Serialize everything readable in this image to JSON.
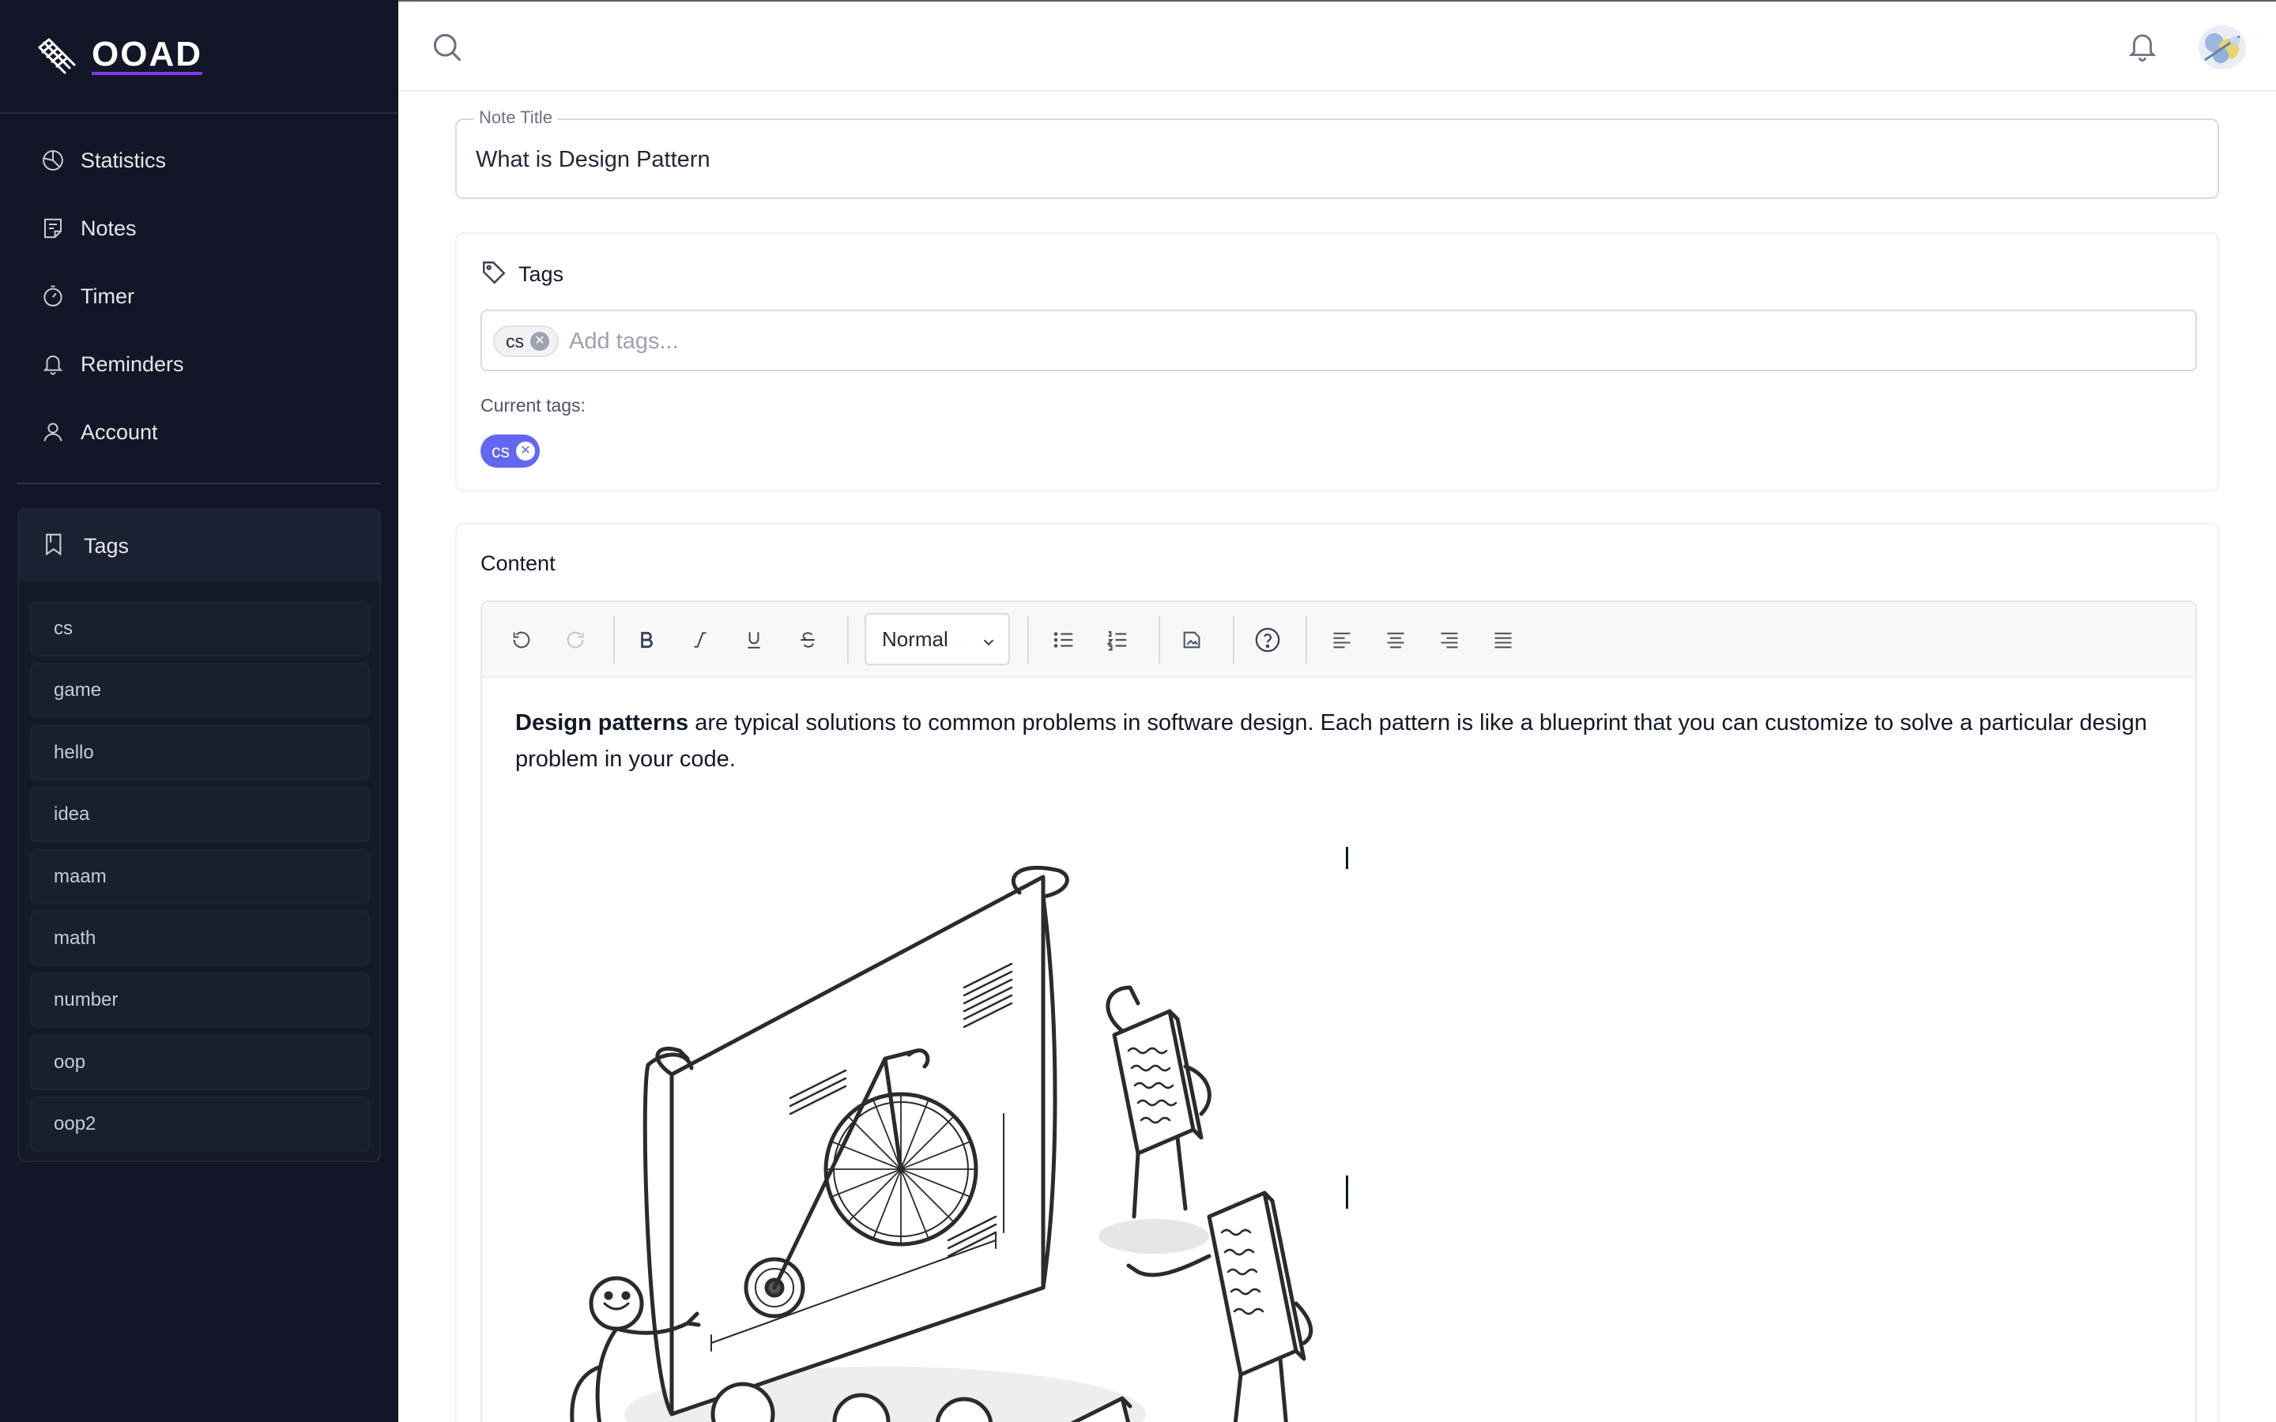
{
  "app": {
    "name": "OOAD"
  },
  "nav": {
    "items": [
      {
        "label": "Statistics",
        "icon": "pie-chart-icon"
      },
      {
        "label": "Notes",
        "icon": "note-icon"
      },
      {
        "label": "Timer",
        "icon": "timer-icon"
      },
      {
        "label": "Reminders",
        "icon": "bell-icon"
      },
      {
        "label": "Account",
        "icon": "user-icon"
      }
    ]
  },
  "sidebar_tags": {
    "title": "Tags",
    "items": [
      "cs",
      "game",
      "hello",
      "idea",
      "maam",
      "math",
      "number",
      "oop",
      "oop2"
    ]
  },
  "note": {
    "title_label": "Note Title",
    "title_value": "What is Design Pattern"
  },
  "tags_section": {
    "title": "Tags",
    "input_chip": "cs",
    "placeholder": "Add tags...",
    "current_label": "Current tags:",
    "current_chip": "cs"
  },
  "content_section": {
    "title": "Content",
    "format_select": "Normal",
    "body_bold": "Design patterns",
    "body_rest": " are typical solutions to common problems in software design. Each pattern is like a blueprint that you can customize to solve a particular design problem in your code."
  },
  "colors": {
    "sidebar_bg": "#121626",
    "accent": "#6366f1",
    "brand_underline": "#7c3aed"
  }
}
